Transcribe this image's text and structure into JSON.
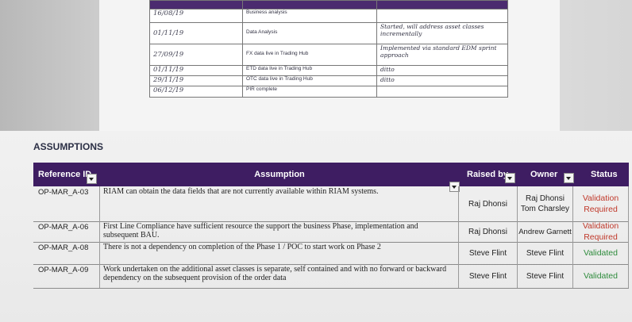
{
  "milestones": [
    {
      "date": "16/08/19",
      "milestone": "Business analysis",
      "comment": ""
    },
    {
      "date": "01/11/19",
      "milestone": "Data Analysis",
      "comment": "Started, will address asset classes incrementally"
    },
    {
      "date": "27/09/19",
      "milestone": "FX data live in Trading Hub",
      "comment": "Implemented via standard EDM sprint approach"
    },
    {
      "date": "01/11/19",
      "milestone": "ETD data live in Trading Hub",
      "comment": "ditto"
    },
    {
      "date": "29/11/19",
      "milestone": "OTC data live in Trading Hub",
      "comment": "ditto"
    },
    {
      "date": "06/12/19",
      "milestone": "PIR complete",
      "comment": ""
    }
  ],
  "section_title": "ASSUMPTIONS",
  "columns": {
    "reference": "Reference ID",
    "assumption": "Assumption",
    "raised_by": "Raised by",
    "owner": "Owner",
    "status": "Status"
  },
  "rows": [
    {
      "ref": "OP-MAR_A-03",
      "assumption": "RIAM can obtain the data fields that are not currently available within RIAM systems.",
      "raised_by": "Raj Dhonsi",
      "owner": "Raj Dhonsi Tom Charsley",
      "status": "Validation Required"
    },
    {
      "ref": "OP-MAR_A-06",
      "assumption": "First Line Compliance have sufficient resource the support the business Phase, implementation and subsequent BAU.",
      "raised_by": "Raj Dhonsi",
      "owner": "Andrew Garnett",
      "status": "Validation Required"
    },
    {
      "ref": "OP-MAR_A-08",
      "assumption": "There is not a dependency on completion of the Phase 1 / POC to start work on Phase 2",
      "raised_by": "Steve Flint",
      "owner": "Steve Flint",
      "status": "Validated"
    },
    {
      "ref": "OP-MAR_A-09",
      "assumption": "Work undertaken on the additional asset classes is separate, self contained and with no forward or backward dependency on the subsequent provision of the order data",
      "raised_by": "Steve Flint",
      "owner": "Steve Flint",
      "status": "Validated"
    }
  ],
  "colors": {
    "header": "#3e1d62",
    "required": "#c0392b",
    "validated": "#2e8b3c"
  }
}
